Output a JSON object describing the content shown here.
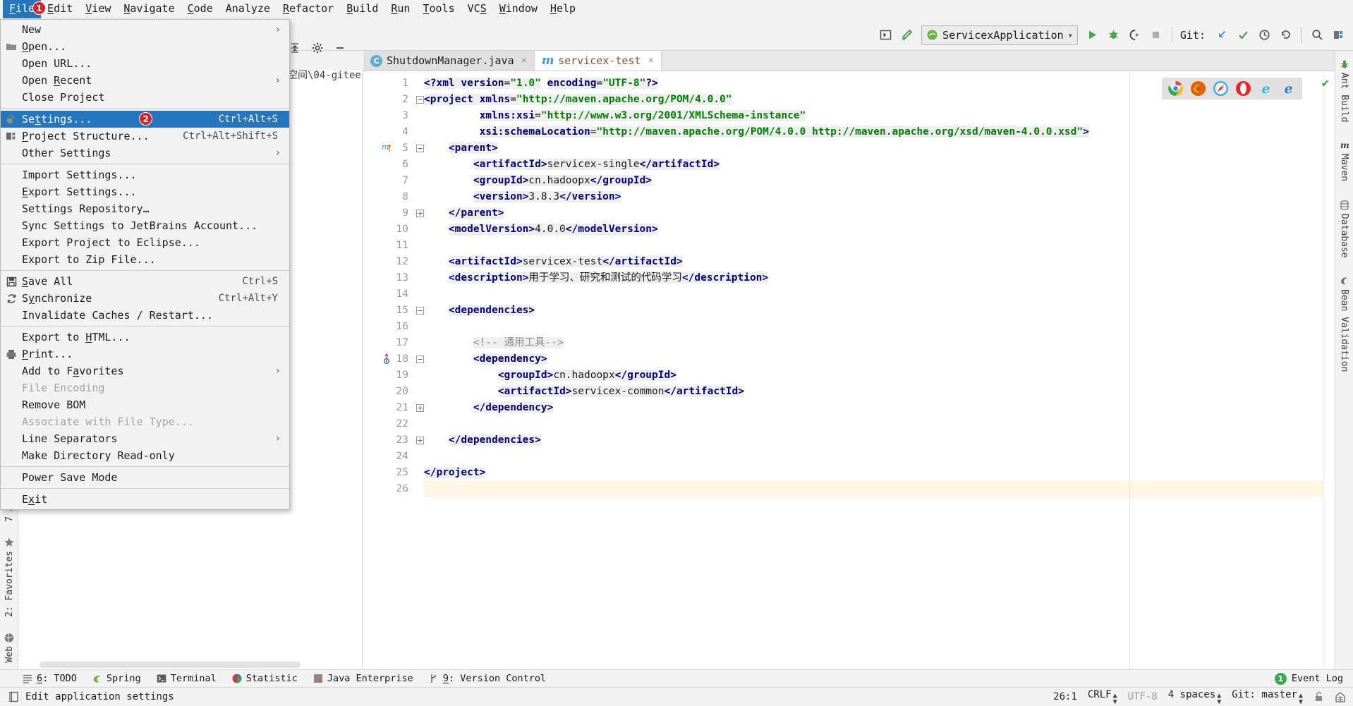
{
  "menubar": {
    "items": [
      {
        "label": "File",
        "mnemonic": "F",
        "active": true
      },
      {
        "label": "Edit",
        "mnemonic": "E",
        "active": false
      },
      {
        "label": "View",
        "mnemonic": "V",
        "active": false
      },
      {
        "label": "Navigate",
        "mnemonic": "N",
        "active": false
      },
      {
        "label": "Code",
        "mnemonic": "C",
        "active": false
      },
      {
        "label": "Analyze",
        "mnemonic": "",
        "active": false
      },
      {
        "label": "Refactor",
        "mnemonic": "R",
        "active": false
      },
      {
        "label": "Build",
        "mnemonic": "B",
        "active": false
      },
      {
        "label": "Run",
        "mnemonic": "R",
        "active": false
      },
      {
        "label": "Tools",
        "mnemonic": "T",
        "active": false
      },
      {
        "label": "VCS",
        "mnemonic": "S",
        "active": false
      },
      {
        "label": "Window",
        "mnemonic": "W",
        "active": false
      },
      {
        "label": "Help",
        "mnemonic": "H",
        "active": false
      }
    ],
    "file_badge": "1"
  },
  "file_menu": {
    "settings_badge": "2",
    "items": [
      {
        "label": "New",
        "accel": "",
        "arrow": "›",
        "icon": "",
        "selected": false,
        "disabled": false
      },
      {
        "label": "Open...",
        "accel": "",
        "arrow": "",
        "icon": "folder-icon",
        "selected": false,
        "disabled": false
      },
      {
        "label": "Open URL...",
        "accel": "",
        "arrow": "",
        "icon": "",
        "selected": false,
        "disabled": false
      },
      {
        "label": "Open Recent",
        "accel": "",
        "arrow": "›",
        "icon": "",
        "selected": false,
        "disabled": false
      },
      {
        "label": "Close Project",
        "accel": "",
        "arrow": "",
        "icon": "",
        "selected": false,
        "disabled": false
      },
      {
        "separator": true
      },
      {
        "label": "Settings...",
        "accel": "Ctrl+Alt+S",
        "arrow": "",
        "icon": "wrench-icon",
        "selected": true,
        "disabled": false
      },
      {
        "label": "Project Structure...",
        "accel": "Ctrl+Alt+Shift+S",
        "arrow": "",
        "icon": "module-icon",
        "selected": false,
        "disabled": false
      },
      {
        "label": "Other Settings",
        "accel": "",
        "arrow": "›",
        "icon": "",
        "selected": false,
        "disabled": false
      },
      {
        "separator": true
      },
      {
        "label": "Import Settings...",
        "accel": "",
        "arrow": "",
        "icon": "",
        "selected": false,
        "disabled": false
      },
      {
        "label": "Export Settings...",
        "accel": "",
        "arrow": "",
        "icon": "",
        "selected": false,
        "disabled": false
      },
      {
        "label": "Settings Repository…",
        "accel": "",
        "arrow": "",
        "icon": "",
        "selected": false,
        "disabled": false
      },
      {
        "label": "Sync Settings to JetBrains Account...",
        "accel": "",
        "arrow": "",
        "icon": "",
        "selected": false,
        "disabled": false
      },
      {
        "label": "Export Project to Eclipse...",
        "accel": "",
        "arrow": "",
        "icon": "",
        "selected": false,
        "disabled": false
      },
      {
        "label": "Export to Zip File...",
        "accel": "",
        "arrow": "",
        "icon": "",
        "selected": false,
        "disabled": false
      },
      {
        "separator": true
      },
      {
        "label": "Save All",
        "accel": "Ctrl+S",
        "arrow": "",
        "icon": "save-icon",
        "selected": false,
        "disabled": false
      },
      {
        "label": "Synchronize",
        "accel": "Ctrl+Alt+Y",
        "arrow": "",
        "icon": "sync-icon",
        "selected": false,
        "disabled": false
      },
      {
        "label": "Invalidate Caches / Restart...",
        "accel": "",
        "arrow": "",
        "icon": "",
        "selected": false,
        "disabled": false
      },
      {
        "separator": true
      },
      {
        "label": "Export to HTML...",
        "accel": "",
        "arrow": "",
        "icon": "",
        "selected": false,
        "disabled": false
      },
      {
        "label": "Print...",
        "accel": "",
        "arrow": "",
        "icon": "printer-icon",
        "selected": false,
        "disabled": false
      },
      {
        "label": "Add to Favorites",
        "accel": "",
        "arrow": "›",
        "icon": "",
        "selected": false,
        "disabled": false
      },
      {
        "label": "File Encoding",
        "accel": "",
        "arrow": "",
        "icon": "",
        "selected": false,
        "disabled": true
      },
      {
        "label": "Remove BOM",
        "accel": "",
        "arrow": "",
        "icon": "",
        "selected": false,
        "disabled": false
      },
      {
        "label": "Associate with File Type...",
        "accel": "",
        "arrow": "",
        "icon": "",
        "selected": false,
        "disabled": true
      },
      {
        "label": "Line Separators",
        "accel": "",
        "arrow": "›",
        "icon": "",
        "selected": false,
        "disabled": false
      },
      {
        "label": "Make Directory Read-only",
        "accel": "",
        "arrow": "",
        "icon": "",
        "selected": false,
        "disabled": false
      },
      {
        "separator": true
      },
      {
        "label": "Power Save Mode",
        "accel": "",
        "arrow": "",
        "icon": "",
        "selected": false,
        "disabled": false
      },
      {
        "separator": true
      },
      {
        "label": "Exit",
        "accel": "",
        "arrow": "",
        "icon": "",
        "selected": false,
        "disabled": false
      }
    ]
  },
  "toolbar": {
    "run_config": "ServicexApplication",
    "git_label": "Git:",
    "buttons": [
      {
        "name": "open-tool-window-icon"
      },
      {
        "name": "build-hammer-icon"
      },
      {
        "name": "run-icon"
      },
      {
        "name": "debug-icon"
      },
      {
        "name": "run-with-coverage-icon"
      },
      {
        "name": "stop-icon"
      },
      {
        "name": "git-update-icon"
      },
      {
        "name": "git-commit-icon"
      },
      {
        "name": "git-history-icon"
      },
      {
        "name": "git-rollback-icon"
      },
      {
        "name": "search-everywhere-icon"
      },
      {
        "name": "project-structure-icon"
      }
    ]
  },
  "project_pane": {
    "path_fragment": "空间\\04-gitee"
  },
  "editor": {
    "tabs": [
      {
        "label": "ShutdownManager.java",
        "icon": "java-class-icon",
        "active": false
      },
      {
        "label": "servicex-test",
        "icon": "maven-module-icon",
        "active": true
      }
    ],
    "browsers": [
      "chrome-icon",
      "firefox-icon",
      "safari-icon",
      "opera-icon",
      "ie-icon",
      "edge-icon"
    ],
    "lines": [
      {
        "n": 1,
        "fold": "",
        "gicon": "",
        "caret": false,
        "segs": [
          {
            "c": "pi",
            "t": "<?xml "
          },
          {
            "c": "attr",
            "t": "version"
          },
          {
            "c": "txt",
            "t": "="
          },
          {
            "c": "val",
            "t": "\"1.0\""
          },
          {
            "c": "txt",
            "t": " "
          },
          {
            "c": "attr",
            "t": "encoding"
          },
          {
            "c": "txt",
            "t": "="
          },
          {
            "c": "val",
            "t": "\"UTF-8\""
          },
          {
            "c": "pi",
            "t": "?>"
          }
        ]
      },
      {
        "n": 2,
        "fold": "-",
        "gicon": "",
        "caret": false,
        "segs": [
          {
            "c": "tag",
            "t": "<project "
          },
          {
            "c": "attr",
            "t": "xmlns"
          },
          {
            "c": "txt",
            "t": "="
          },
          {
            "c": "val",
            "t": "\"http://maven.apache.org/POM/4.0.0\""
          }
        ]
      },
      {
        "n": 3,
        "fold": "",
        "gicon": "",
        "caret": false,
        "segs": [
          {
            "c": "txt",
            "t": "         "
          },
          {
            "c": "attr",
            "t": "xmlns:xsi"
          },
          {
            "c": "txt",
            "t": "="
          },
          {
            "c": "val",
            "t": "\"http://www.w3.org/2001/XMLSchema-instance\""
          }
        ]
      },
      {
        "n": 4,
        "fold": "",
        "gicon": "",
        "caret": false,
        "segs": [
          {
            "c": "txt",
            "t": "         "
          },
          {
            "c": "attr",
            "t": "xsi:schemaLocation"
          },
          {
            "c": "txt",
            "t": "="
          },
          {
            "c": "val",
            "t": "\"http://maven.apache.org/POM/4.0.0 http://maven.apache.org/xsd/maven-4.0.0.xsd\""
          },
          {
            "c": "tag",
            "t": ">"
          }
        ]
      },
      {
        "n": 5,
        "fold": "-",
        "gicon": "maven-icon",
        "caret": false,
        "segs": [
          {
            "c": "txt",
            "t": "    "
          },
          {
            "c": "tag",
            "t": "<parent>"
          }
        ]
      },
      {
        "n": 6,
        "fold": "",
        "gicon": "",
        "caret": false,
        "segs": [
          {
            "c": "txt",
            "t": "        "
          },
          {
            "c": "tag",
            "t": "<artifactId>"
          },
          {
            "c": "txt",
            "t": "servicex-single"
          },
          {
            "c": "tag",
            "t": "</artifactId>"
          }
        ]
      },
      {
        "n": 7,
        "fold": "",
        "gicon": "",
        "caret": false,
        "segs": [
          {
            "c": "txt",
            "t": "        "
          },
          {
            "c": "tag",
            "t": "<groupId>"
          },
          {
            "c": "txt",
            "t": "cn.hadoopx"
          },
          {
            "c": "tag",
            "t": "</groupId>"
          }
        ]
      },
      {
        "n": 8,
        "fold": "",
        "gicon": "",
        "caret": false,
        "segs": [
          {
            "c": "txt",
            "t": "        "
          },
          {
            "c": "tag",
            "t": "<version>"
          },
          {
            "c": "txt",
            "t": "3.8.3"
          },
          {
            "c": "tag",
            "t": "</version>"
          }
        ]
      },
      {
        "n": 9,
        "fold": "+",
        "gicon": "",
        "caret": false,
        "segs": [
          {
            "c": "txt",
            "t": "    "
          },
          {
            "c": "tag",
            "t": "</parent>"
          }
        ]
      },
      {
        "n": 10,
        "fold": "",
        "gicon": "",
        "caret": false,
        "segs": [
          {
            "c": "txt",
            "t": "    "
          },
          {
            "c": "tag",
            "t": "<modelVersion>"
          },
          {
            "c": "txt",
            "t": "4.0.0"
          },
          {
            "c": "tag",
            "t": "</modelVersion>"
          }
        ]
      },
      {
        "n": 11,
        "fold": "",
        "gicon": "",
        "caret": false,
        "segs": []
      },
      {
        "n": 12,
        "fold": "",
        "gicon": "",
        "caret": false,
        "segs": [
          {
            "c": "txt",
            "t": "    "
          },
          {
            "c": "tag",
            "t": "<artifactId>"
          },
          {
            "c": "txt",
            "t": "servicex-test"
          },
          {
            "c": "tag",
            "t": "</artifactId>"
          }
        ]
      },
      {
        "n": 13,
        "fold": "",
        "gicon": "",
        "caret": false,
        "segs": [
          {
            "c": "txt",
            "t": "    "
          },
          {
            "c": "tag",
            "t": "<description>"
          },
          {
            "c": "txt",
            "t": "用于学习、研究和测试的代码学习"
          },
          {
            "c": "tag",
            "t": "</description>"
          }
        ]
      },
      {
        "n": 14,
        "fold": "",
        "gicon": "",
        "caret": false,
        "segs": []
      },
      {
        "n": 15,
        "fold": "-",
        "gicon": "",
        "caret": false,
        "segs": [
          {
            "c": "txt",
            "t": "    "
          },
          {
            "c": "tag",
            "t": "<dependencies>"
          }
        ]
      },
      {
        "n": 16,
        "fold": "",
        "gicon": "",
        "caret": false,
        "segs": []
      },
      {
        "n": 17,
        "fold": "",
        "gicon": "",
        "caret": false,
        "segs": [
          {
            "c": "txt",
            "t": "        "
          },
          {
            "c": "cmt",
            "t": "<!-- 通用工具-->"
          }
        ]
      },
      {
        "n": 18,
        "fold": "-",
        "gicon": "dependency-icon",
        "caret": false,
        "segs": [
          {
            "c": "txt",
            "t": "        "
          },
          {
            "c": "tag",
            "t": "<dependency>"
          }
        ]
      },
      {
        "n": 19,
        "fold": "",
        "gicon": "",
        "caret": false,
        "segs": [
          {
            "c": "txt",
            "t": "            "
          },
          {
            "c": "tag",
            "t": "<groupId>"
          },
          {
            "c": "txt",
            "t": "cn.hadoopx"
          },
          {
            "c": "tag",
            "t": "</groupId>"
          }
        ]
      },
      {
        "n": 20,
        "fold": "",
        "gicon": "",
        "caret": false,
        "segs": [
          {
            "c": "txt",
            "t": "            "
          },
          {
            "c": "tag",
            "t": "<artifactId>"
          },
          {
            "c": "txt",
            "t": "servicex-common"
          },
          {
            "c": "tag",
            "t": "</artifactId>"
          }
        ]
      },
      {
        "n": 21,
        "fold": "+",
        "gicon": "",
        "caret": false,
        "segs": [
          {
            "c": "txt",
            "t": "        "
          },
          {
            "c": "tag",
            "t": "</dependency>"
          }
        ]
      },
      {
        "n": 22,
        "fold": "",
        "gicon": "",
        "caret": false,
        "segs": []
      },
      {
        "n": 23,
        "fold": "+",
        "gicon": "",
        "caret": false,
        "segs": [
          {
            "c": "txt",
            "t": "    "
          },
          {
            "c": "tag",
            "t": "</dependencies>"
          }
        ]
      },
      {
        "n": 24,
        "fold": "",
        "gicon": "",
        "caret": false,
        "segs": []
      },
      {
        "n": 25,
        "fold": "",
        "gicon": "",
        "caret": false,
        "segs": [
          {
            "c": "tag",
            "t": "</project>"
          }
        ]
      },
      {
        "n": 26,
        "fold": "",
        "gicon": "",
        "caret": true,
        "segs": []
      }
    ]
  },
  "left_rail": {
    "items": [
      {
        "label": "7",
        "icon": "structure-icon"
      },
      {
        "label": "2: Favorites",
        "icon": "star-icon"
      },
      {
        "label": "Web",
        "icon": "globe-icon"
      }
    ]
  },
  "right_rail": {
    "items": [
      {
        "label": "Ant Build",
        "icon": "ant-icon"
      },
      {
        "label": "Maven",
        "icon": "maven-icon"
      },
      {
        "label": "Database",
        "icon": "database-icon"
      },
      {
        "label": "Bean Validation",
        "icon": "bean-icon"
      }
    ]
  },
  "bottom_bar": {
    "items": [
      {
        "label": "6: TODO",
        "icon": "todo-icon"
      },
      {
        "label": "Spring",
        "icon": "spring-icon"
      },
      {
        "label": "Terminal",
        "icon": "terminal-icon"
      },
      {
        "label": "Statistic",
        "icon": "statistic-icon"
      },
      {
        "label": "Java Enterprise",
        "icon": "java-enterprise-icon"
      },
      {
        "label": "9: Version Control",
        "icon": "version-control-icon"
      }
    ],
    "event_log": "Event Log",
    "event_log_badge": "1"
  },
  "status_bar": {
    "message": "Edit application settings",
    "caret_position": "26:1",
    "line_separator": "CRLF",
    "encoding": "UTF-8",
    "indent": "4 spaces",
    "git_branch": "Git: master"
  },
  "colors": {
    "accent_blue": "#2675bf",
    "badge_red": "#e02020",
    "badge_green": "#3aaa55",
    "tag_navy": "#000080",
    "value_green": "#008000",
    "comment_gray": "#8c8c8c"
  }
}
